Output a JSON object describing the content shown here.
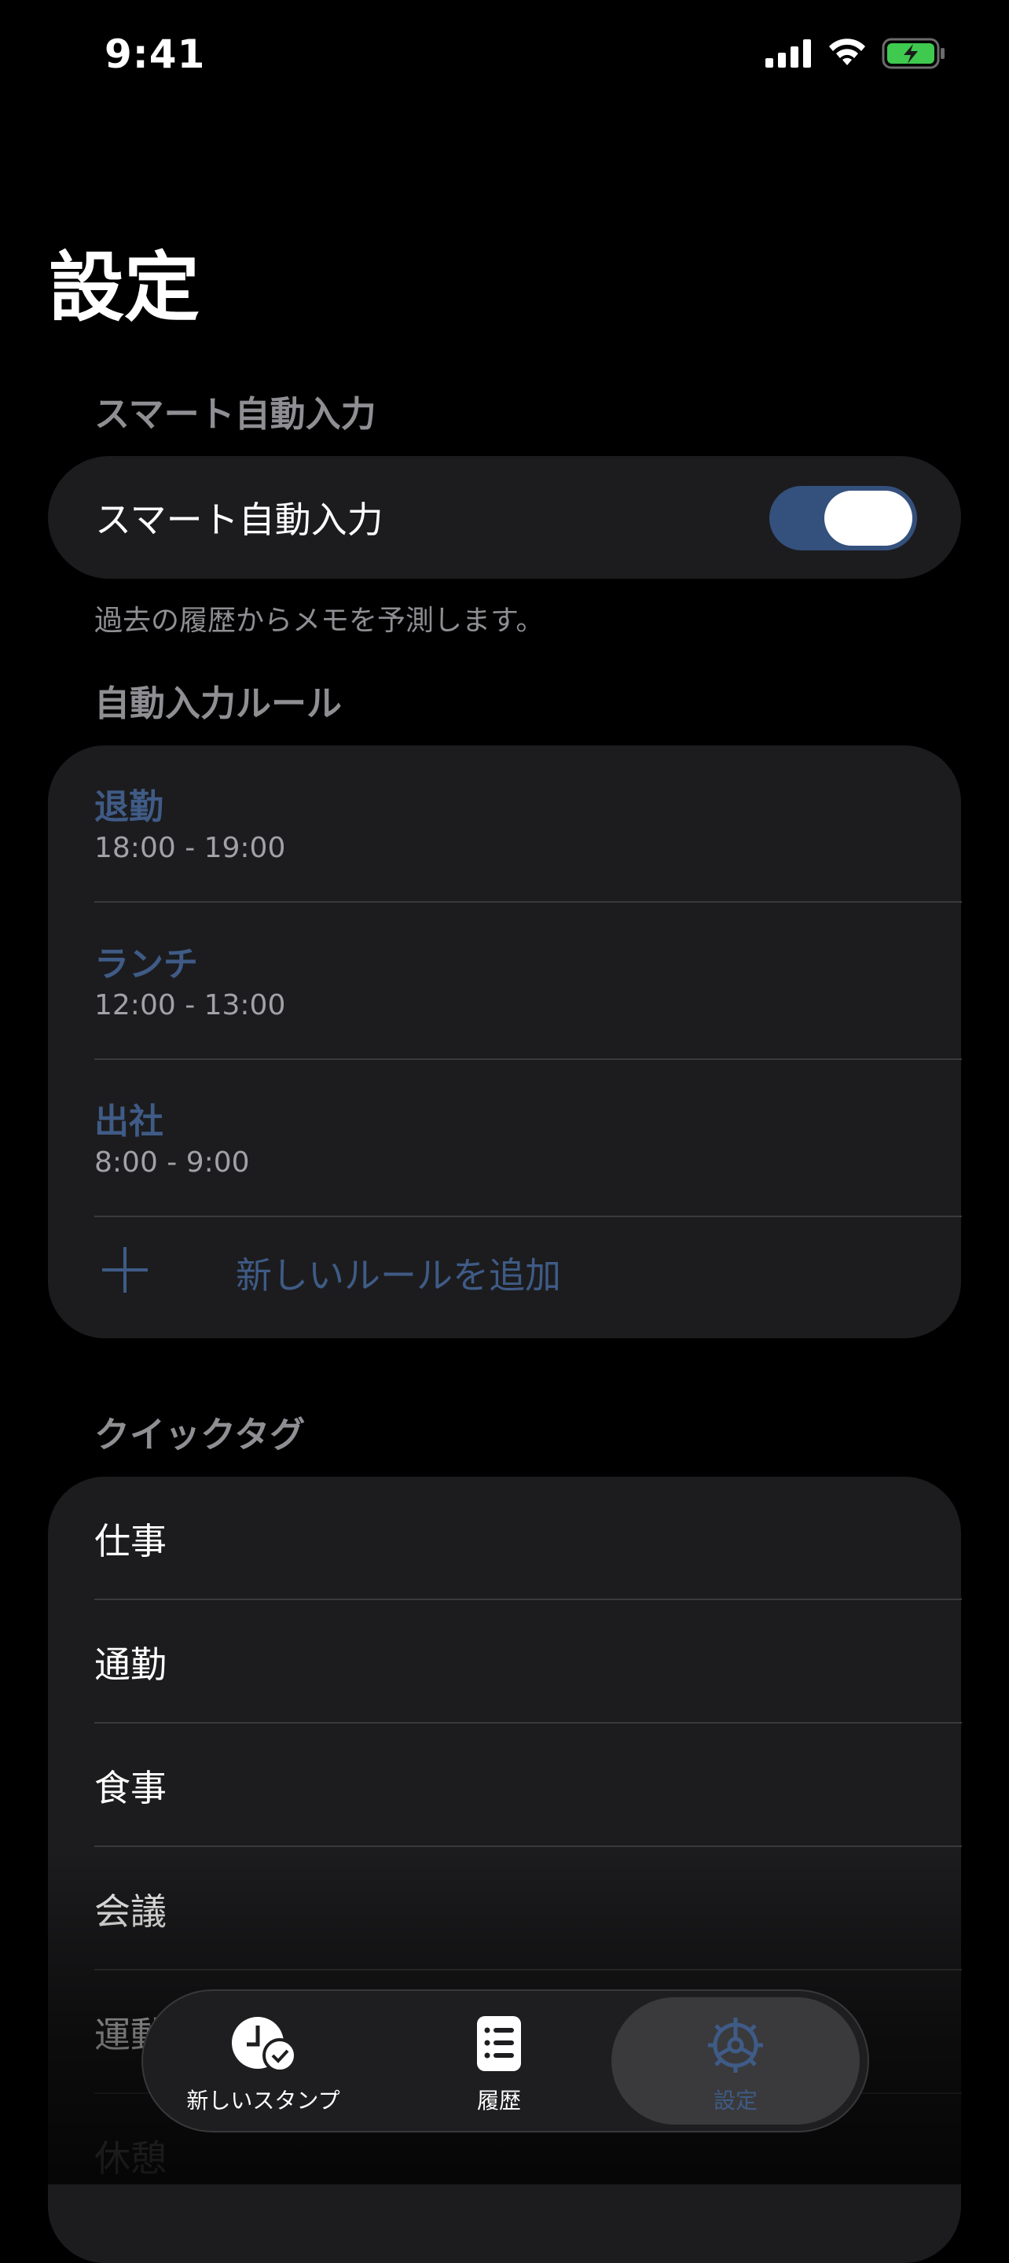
{
  "status_bar": {
    "time": "9:41"
  },
  "page": {
    "title": "設定"
  },
  "smart_input": {
    "section_header": "スマート自動入力",
    "toggle_label": "スマート自動入力",
    "toggle_on": true,
    "footnote": "過去の履歴からメモを予測します。"
  },
  "rules": {
    "section_header": "自動入力ルール",
    "items": [
      {
        "name": "退勤",
        "time": "18:00 - 19:00"
      },
      {
        "name": "ランチ",
        "time": "12:00 - 13:00"
      },
      {
        "name": "出社",
        "time": "8:00 - 9:00"
      }
    ],
    "add_label": "新しいルールを追加"
  },
  "quick_tags": {
    "section_header": "クイックタグ",
    "items": [
      "仕事",
      "通勤",
      "食事",
      "会議",
      "運動",
      "休憩"
    ]
  },
  "tab_bar": {
    "tabs": [
      {
        "label": "新しいスタンプ",
        "icon": "clock-check-icon"
      },
      {
        "label": "履歴",
        "icon": "list-icon"
      },
      {
        "label": "設定",
        "icon": "gear-icon",
        "active": true
      }
    ]
  },
  "colors": {
    "accent": "#3f5b86",
    "toggle_on": "#34507c",
    "background": "#000000",
    "group_background": "#1c1c1e",
    "secondary_text": "#8e8e93"
  }
}
